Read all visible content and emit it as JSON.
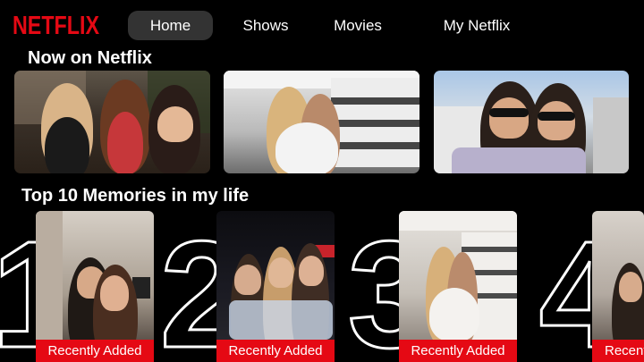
{
  "brand": {
    "logo_text": "NETFLIX",
    "color": "#e50914"
  },
  "nav": {
    "items": [
      {
        "label": "Home",
        "active": true
      },
      {
        "label": "Shows",
        "active": false
      },
      {
        "label": "Movies",
        "active": false
      },
      {
        "label": "My Netflix",
        "active": false
      }
    ]
  },
  "now_on": {
    "title": "Now on Netflix",
    "tiles": [
      {
        "icon": "photo-three-friends-hugging"
      },
      {
        "icon": "photo-two-friends-on-yacht"
      },
      {
        "icon": "photo-two-friends-sunglasses-marina"
      }
    ]
  },
  "top10": {
    "title": "Top 10 Memories in my life",
    "items": [
      {
        "rank": "1",
        "badge": "Recently Added",
        "icon": "photo-two-friends-indoor"
      },
      {
        "rank": "2",
        "badge": "Recently Added",
        "icon": "photo-group-night-out"
      },
      {
        "rank": "3",
        "badge": "Recently Added",
        "icon": "photo-two-friends-yacht-stairs"
      },
      {
        "rank": "4",
        "badge": "Recently Added",
        "icon": "photo-friend-hallway"
      }
    ]
  },
  "colors": {
    "background": "#000000",
    "active_tab": "#333333",
    "badge": "#e50914"
  }
}
